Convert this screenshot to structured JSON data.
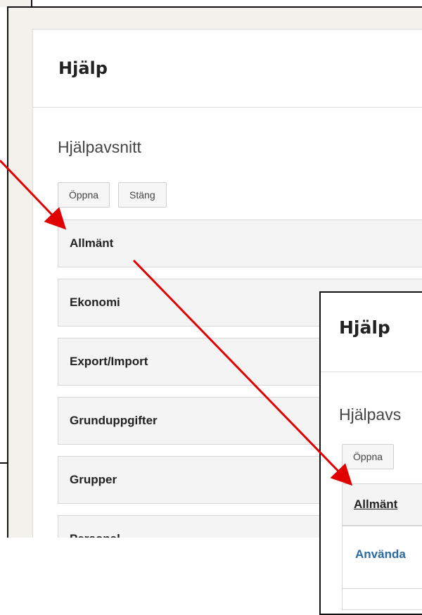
{
  "main_panel": {
    "title": "Hjälp",
    "subtitle": "Hjälpavsnitt",
    "buttons": {
      "open": "Öppna",
      "close": "Stäng"
    },
    "sections": [
      "Allmänt",
      "Ekonomi",
      "Export/Import",
      "Grunduppgifter",
      "Grupper",
      "Personal",
      ""
    ]
  },
  "overlay_panel": {
    "title": "Hjälp",
    "subtitle": "Hjälpavs",
    "open_button": "Öppna",
    "expanded_section": "Allmänt",
    "first_link": "Använda"
  },
  "annotation": {
    "arrow_color": "#e00000"
  }
}
